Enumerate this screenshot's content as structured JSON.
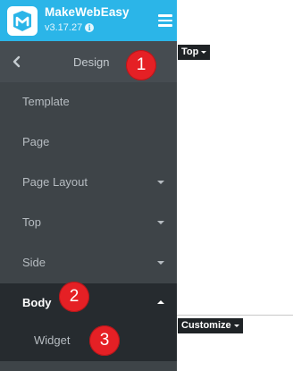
{
  "header": {
    "app_name": "MakeWebEasy",
    "version": "v3.17.27",
    "brand_color": "#2bb5e8",
    "logo_icon": "makewebeasy-logo-icon",
    "info_icon": "info-icon",
    "menu_icon": "hamburger-menu-icon"
  },
  "sidebar": {
    "back_icon": "chevron-left-icon",
    "section_title": "Design",
    "items": [
      {
        "label": "Template",
        "has_caret": false
      },
      {
        "label": "Page",
        "has_caret": false
      },
      {
        "label": "Page Layout",
        "has_caret": true
      },
      {
        "label": "Top",
        "has_caret": true
      },
      {
        "label": "Side",
        "has_caret": true
      },
      {
        "label": "Body",
        "has_caret": true,
        "expanded": true
      }
    ],
    "sub_items": [
      {
        "label": "Widget"
      }
    ]
  },
  "badges": [
    {
      "number": "1"
    },
    {
      "number": "2"
    },
    {
      "number": "3"
    }
  ],
  "canvas": {
    "top_tag": "Top",
    "customize_tag": "Customize"
  }
}
